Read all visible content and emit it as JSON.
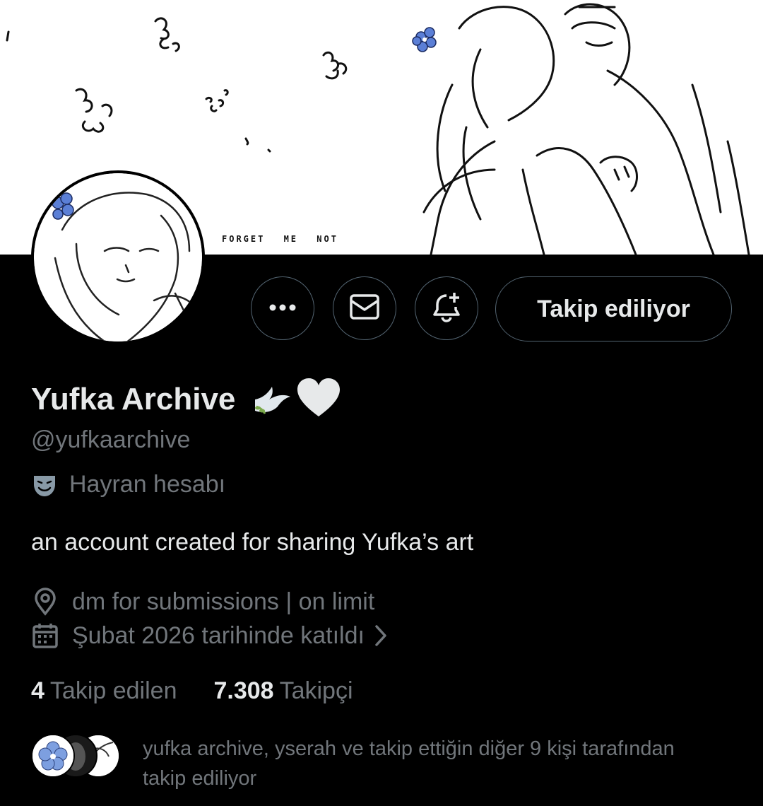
{
  "banner": {
    "caption": "FORGET ME NOT"
  },
  "actions": {
    "more_icon": "more-horizontal-icon",
    "message_icon": "envelope-icon",
    "notify_icon": "bell-plus-icon",
    "follow_label": "Takip ediliyor"
  },
  "profile": {
    "display_name": "Yufka Archive",
    "name_emoji": [
      "dove-icon",
      "white-heart-icon"
    ],
    "handle": "@yufkaarchive",
    "category_icon": "performing-arts-masks-icon",
    "category": "Hayran hesabı",
    "bio": "an account created for sharing Yufka’s art",
    "location": "dm for submissions | on limit",
    "joined": "Şubat 2026 tarihinde katıldı"
  },
  "stats": {
    "following_count": "4",
    "following_label": "Takip edilen",
    "followers_count": "7.308",
    "followers_label": "Takipçi"
  },
  "known_followers": {
    "text": "yufka archive, yserah ve takip ettiğin diğer 9 kişi tarafından takip ediliyor"
  },
  "colors": {
    "background": "#000000",
    "text_primary": "#e7e9ea",
    "text_secondary": "#71767b",
    "border": "#536471",
    "flower_blue": "#5b7fd6"
  }
}
